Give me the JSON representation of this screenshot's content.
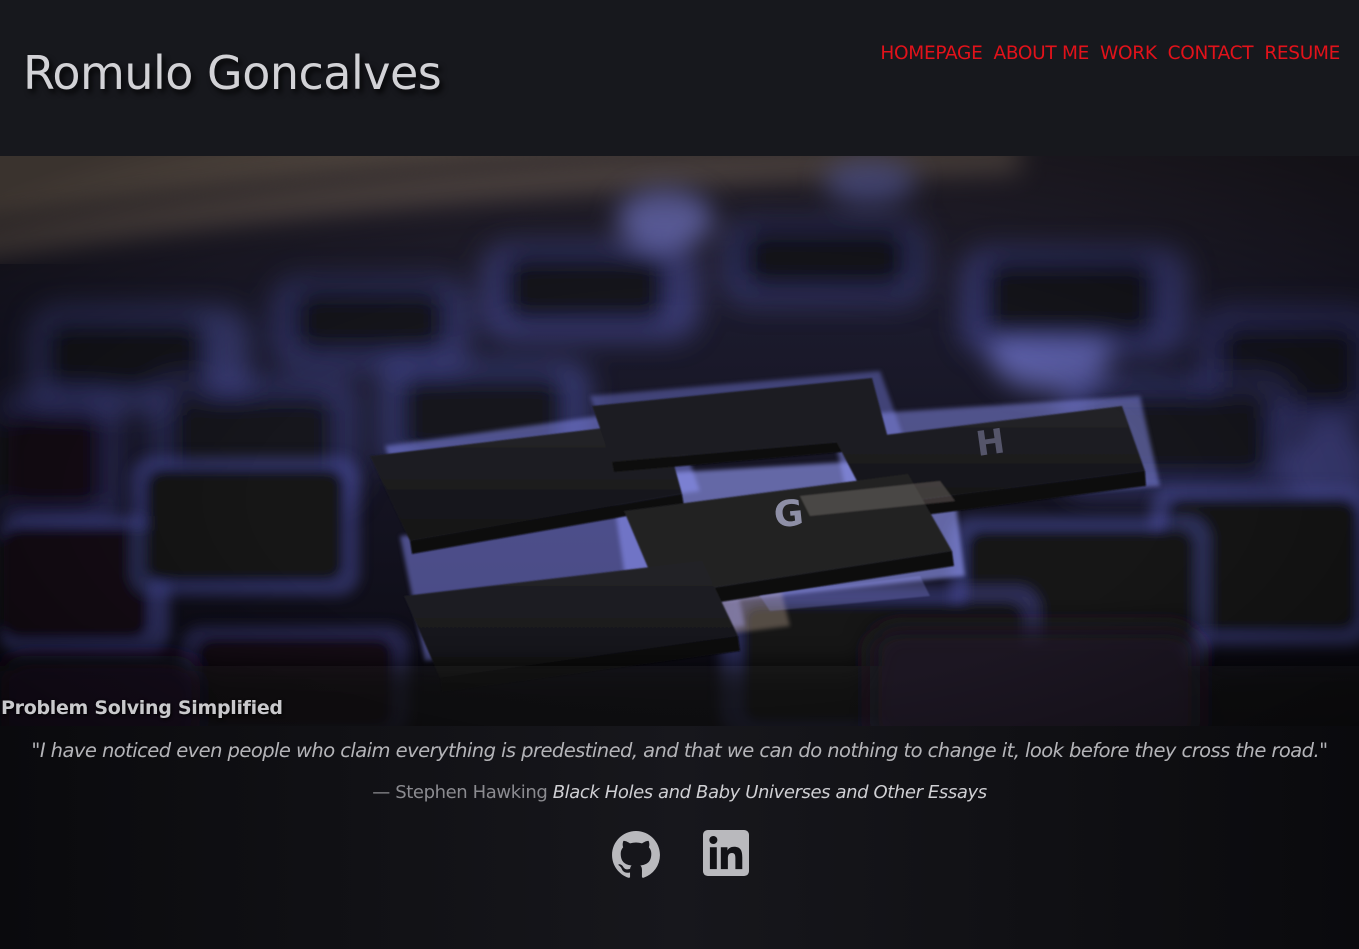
{
  "header": {
    "title": "Romulo Goncalves"
  },
  "nav": {
    "items": [
      {
        "label": "HOMEPAGE"
      },
      {
        "label": "ABOUT ME"
      },
      {
        "label": "WORK"
      },
      {
        "label": "CONTACT"
      },
      {
        "label": "RESUME"
      }
    ],
    "link_color": "#e2121a"
  },
  "hero": {
    "image": "keyboard-closeup-photo",
    "key_letters": [
      "G",
      "H"
    ],
    "caption": "Problem Solving Simplified"
  },
  "quote": {
    "text": "\"I have noticed even people who claim everything is predestined, and that we can do nothing to change it, look before they cross the road.\"",
    "author": "— Stephen Hawking",
    "source": "Black Holes and Baby Universes and Other Essays"
  },
  "social": {
    "links": [
      {
        "icon": "github-icon"
      },
      {
        "icon": "linkedin-icon"
      }
    ]
  }
}
